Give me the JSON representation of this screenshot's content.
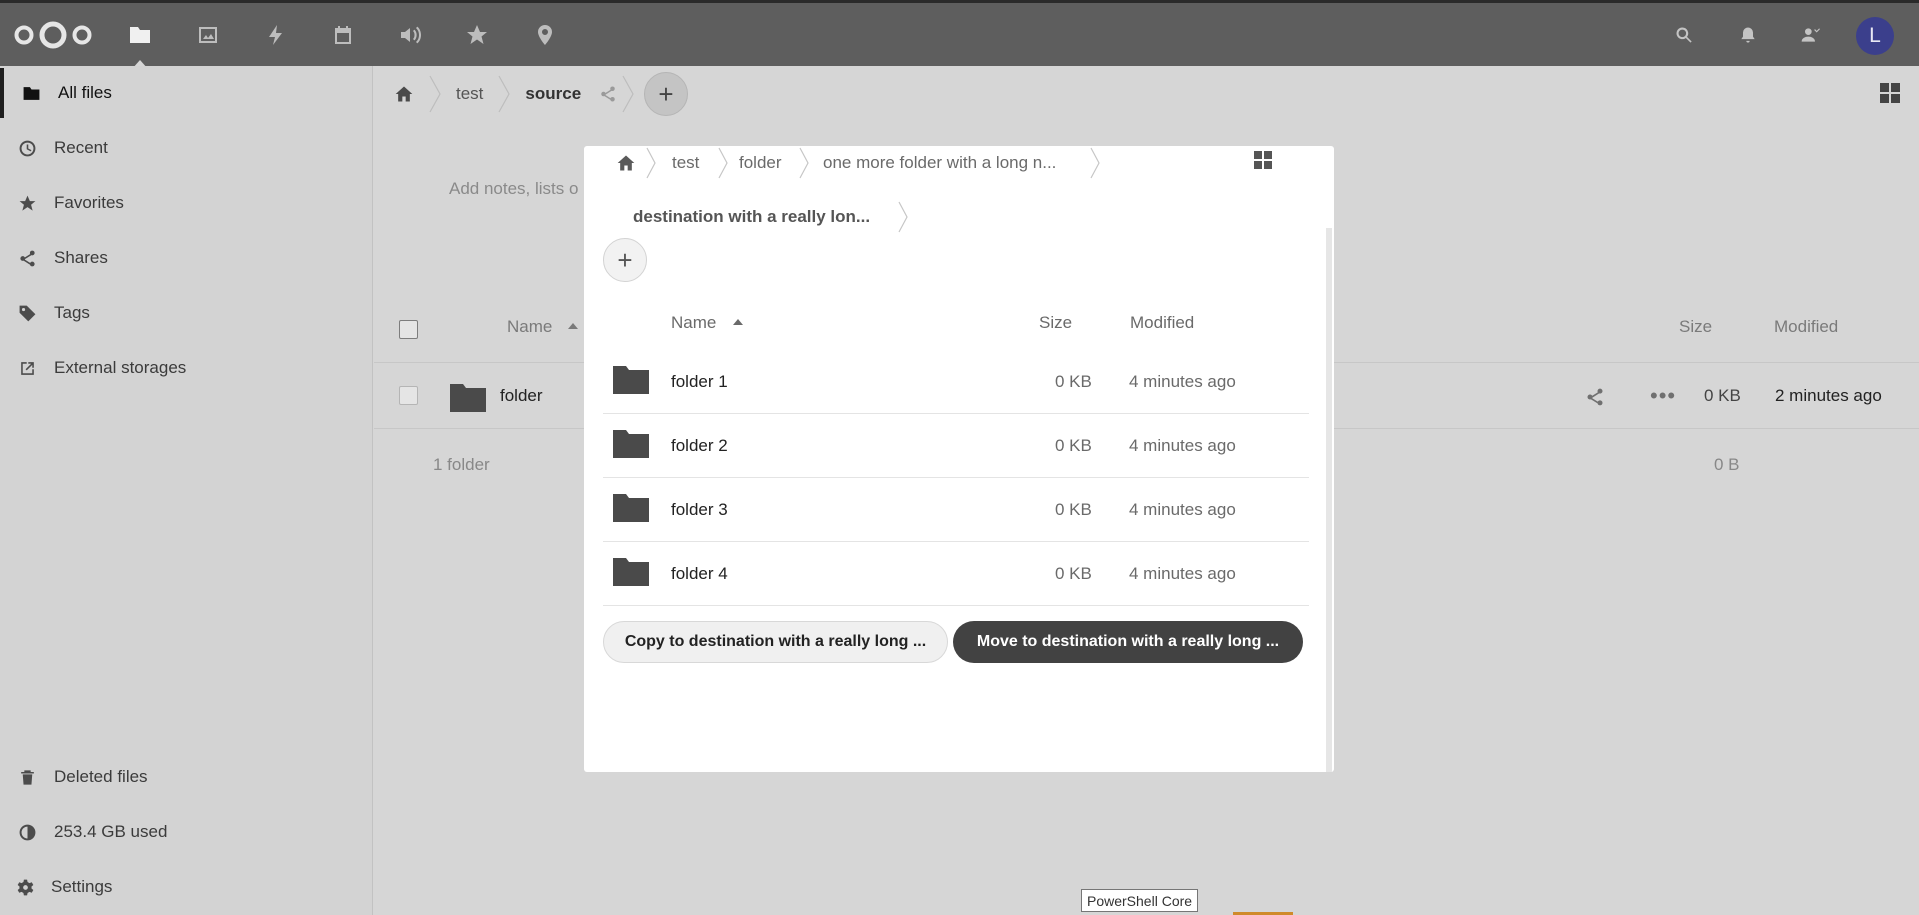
{
  "header": {
    "apps": [
      {
        "name": "files"
      },
      {
        "name": "photos"
      },
      {
        "name": "activity"
      },
      {
        "name": "calendar"
      },
      {
        "name": "audio"
      },
      {
        "name": "favorites"
      },
      {
        "name": "maps"
      }
    ],
    "avatar_letter": "L",
    "avatar_color": "#3b3f8c"
  },
  "sidebar": {
    "items": [
      {
        "label": "All files",
        "icon": "folder-icon"
      },
      {
        "label": "Recent",
        "icon": "clock-icon"
      },
      {
        "label": "Favorites",
        "icon": "star-icon"
      },
      {
        "label": "Shares",
        "icon": "share-icon"
      },
      {
        "label": "Tags",
        "icon": "tag-icon"
      },
      {
        "label": "External storages",
        "icon": "external-link-icon"
      }
    ],
    "footer": [
      {
        "label": "Deleted files",
        "icon": "trash-icon"
      },
      {
        "label": "253.4 GB used",
        "icon": "pie-chart-icon"
      },
      {
        "label": "Settings",
        "icon": "gear-icon"
      }
    ]
  },
  "main": {
    "breadcrumbs": [
      "test",
      "source"
    ],
    "notes_placeholder": "Add notes, lists o",
    "columns": {
      "name": "Name",
      "size": "Size",
      "modified": "Modified"
    },
    "files": [
      {
        "name": "folder",
        "size": "0 KB",
        "modified": "2 minutes ago"
      }
    ],
    "summary": {
      "count": "1 folder",
      "total": "0 B"
    }
  },
  "dialog": {
    "breadcrumbs": [
      "test",
      "folder",
      "one more folder with a long n...",
      "destination with a really lon..."
    ],
    "columns": {
      "name": "Name",
      "size": "Size",
      "modified": "Modified"
    },
    "rows": [
      {
        "name": "folder 1",
        "size": "0 KB",
        "modified": "4 minutes ago"
      },
      {
        "name": "folder 2",
        "size": "0 KB",
        "modified": "4 minutes ago"
      },
      {
        "name": "folder 3",
        "size": "0 KB",
        "modified": "4 minutes ago"
      },
      {
        "name": "folder 4",
        "size": "0 KB",
        "modified": "4 minutes ago"
      }
    ],
    "copy_label": "Copy to destination with a really long ...",
    "move_label": "Move to destination with a really long ..."
  },
  "tooltip": "PowerShell Core"
}
